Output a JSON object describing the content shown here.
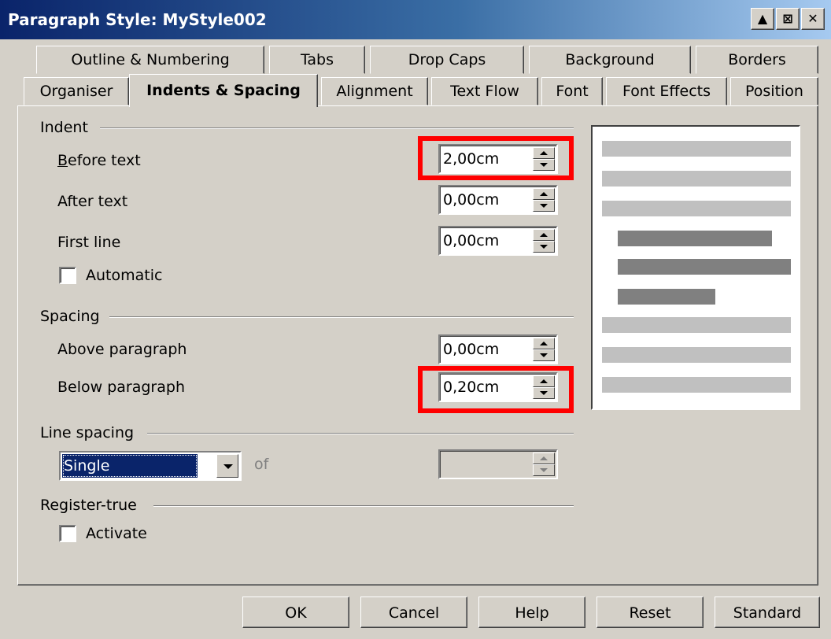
{
  "window": {
    "title": "Paragraph Style: MyStyle002",
    "controls": [
      "minimize-icon",
      "help-pin-icon",
      "close-icon"
    ]
  },
  "tabs": {
    "row1": [
      "Outline & Numbering",
      "Tabs",
      "Drop Caps",
      "Background",
      "Borders"
    ],
    "row2": [
      "Organiser",
      "Indents & Spacing",
      "Alignment",
      "Text Flow",
      "Font",
      "Font Effects",
      "Position"
    ],
    "active": "Indents & Spacing"
  },
  "indent": {
    "section_label": "Indent",
    "before_text_label": "Before text",
    "before_text_value": "2,00cm",
    "after_text_label": "After text",
    "after_text_value": "0,00cm",
    "first_line_label": "First line",
    "first_line_value": "0,00cm",
    "automatic_label": "Automatic",
    "automatic_checked": false
  },
  "spacing": {
    "section_label": "Spacing",
    "above_label": "Above paragraph",
    "above_value": "0,00cm",
    "below_label": "Below paragraph",
    "below_value": "0,20cm"
  },
  "line_spacing": {
    "section_label": "Line spacing",
    "selected": "Single",
    "of_label": "of",
    "of_value": ""
  },
  "register_true": {
    "section_label": "Register-true",
    "activate_label": "Activate",
    "activate_checked": false
  },
  "buttons": {
    "ok": "OK",
    "cancel": "Cancel",
    "help": "Help",
    "reset": "Reset",
    "standard": "Standard"
  },
  "colors": {
    "highlight": "#ff0000",
    "dialog_bg": "#d4d0c8",
    "title_bar": "#0a246a",
    "selection": "#0a246a"
  }
}
